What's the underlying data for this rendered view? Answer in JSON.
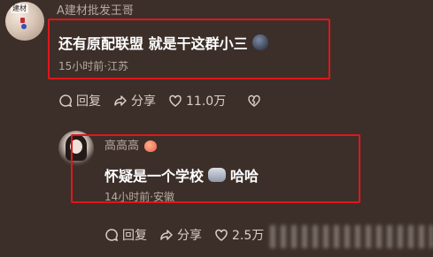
{
  "comment1": {
    "username": "A建材批发王哥",
    "avatar_badge": "建材",
    "text": "还有原配联盟 就是干这群小三",
    "meta": "15小时前·江苏",
    "actions": {
      "reply_label": "回复",
      "share_label": "分享",
      "like_count": "11.0万"
    }
  },
  "comment2": {
    "username": "高高高",
    "text": "怀疑是一个学校",
    "text_suffix": "哈哈",
    "meta": "14小时前·安徽",
    "actions": {
      "reply_label": "回复",
      "share_label": "分享",
      "like_count": "2.5万"
    }
  },
  "icons": [
    "comment-bubble-icon",
    "share-arrow-icon",
    "heart-icon",
    "broken-heart-icon",
    "face-emoji-icon",
    "cat-emoji-icon",
    "peach-icon"
  ],
  "colors": {
    "background": "#3c2f29",
    "highlight_border": "#e0161c",
    "text_primary": "#ffffff",
    "text_secondary": "#b8aaa2"
  }
}
